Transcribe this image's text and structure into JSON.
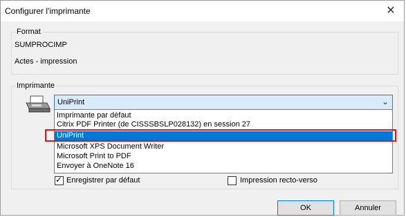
{
  "window": {
    "title": "Configurer l'imprimante",
    "close_icon": "close-icon"
  },
  "format_group": {
    "legend": "Format",
    "line1": "SUMPROCIMP",
    "line2": "Actes - impression"
  },
  "printer_group": {
    "legend": "Imprimante",
    "icon": "printer-icon",
    "selected": "UniPrint",
    "options": [
      "Imprimante par défaut",
      "Citrix PDF Printer (de CISSSBSLP028132) en session 27",
      "UniPrint",
      "Microsoft XPS Document Writer",
      "Microsoft Print to PDF",
      "Envoyer à OneNote 16"
    ],
    "highlighted_index": 2
  },
  "options": {
    "save_default_label": "Enregistrer par défaut",
    "save_default_checked": true,
    "duplex_label": "Impression recto-verso",
    "duplex_checked": false
  },
  "buttons": {
    "ok": "OK",
    "cancel": "Annuler"
  },
  "colors": {
    "accent": "#0078d7",
    "highlight_border": "#e0121b"
  }
}
